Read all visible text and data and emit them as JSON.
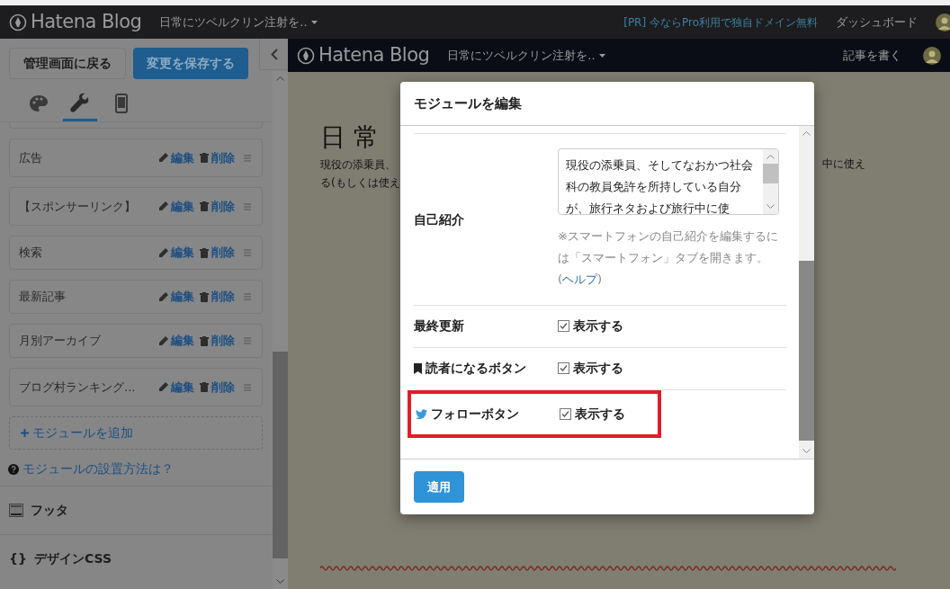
{
  "topbar": {
    "logo": "Hatena Blog",
    "blog_title": "日常にツベルクリン注射を..",
    "promo": "[PR] 今ならPro利用で独自ドメイン無料",
    "dashboard": "ダッシュボード"
  },
  "sidebar": {
    "back_button": "管理画面に戻る",
    "save_button": "変更を保存する",
    "tabs": [
      {
        "kind": "design",
        "selected": false
      },
      {
        "kind": "customize",
        "selected": true
      },
      {
        "kind": "smartphone",
        "selected": false
      }
    ],
    "modules": [
      {
        "name": "広告",
        "edit": "編集",
        "delete": "削除"
      },
      {
        "name": "【スポンサーリンク】",
        "edit": "編集",
        "delete": "削除"
      },
      {
        "name": "検索",
        "edit": "編集",
        "delete": "削除"
      },
      {
        "name": "最新記事",
        "edit": "編集",
        "delete": "削除"
      },
      {
        "name": "月別アーカイブ",
        "edit": "編集",
        "delete": "削除"
      },
      {
        "name": "ブログ村ランキング...",
        "edit": "編集",
        "delete": "削除"
      }
    ],
    "add_module": "モジュールを追加",
    "help_link": "モジュールの設置方法は？",
    "sections": [
      {
        "kind": "footer",
        "label": "フッタ"
      },
      {
        "kind": "css",
        "icon": "{}",
        "label": "デザインCSS"
      }
    ]
  },
  "preview": {
    "logo": "Hatena Blog",
    "blog_title": "日常にツベルクリン注射を..",
    "write_link": "記事を書く",
    "heading": "日 常",
    "intro_lines": [
      "現役の添乗員、",
      "る(もしくは使え"
    ],
    "intro_right": "中に使え"
  },
  "modal": {
    "title": "モジュールを編集",
    "rows": [
      {
        "kind": "textarea",
        "label": "自己紹介",
        "value": "現役の添乗員、そしてなおかつ社会科の教員免許を所持している自分が、旅行ネタおよび旅行中に使",
        "note": "※スマートフォンの自己紹介を編集するには「スマートフォン」タブを開きます。(",
        "note_link": "ヘルプ",
        "note_end": ")"
      },
      {
        "kind": "checkbox",
        "label": "最終更新",
        "option": "表示する",
        "checked": true,
        "highlighted": false
      },
      {
        "kind": "checkbox",
        "label_icon": {
          "kind": "bookmark"
        },
        "label": "読者になるボタン",
        "option": "表示する",
        "checked": true,
        "highlighted": false
      },
      {
        "kind": "checkbox",
        "label_icon": {
          "kind": "bird"
        },
        "label": "フォローボタン",
        "option": "表示する",
        "checked": true,
        "highlighted": true
      }
    ],
    "apply_button": "適用"
  }
}
